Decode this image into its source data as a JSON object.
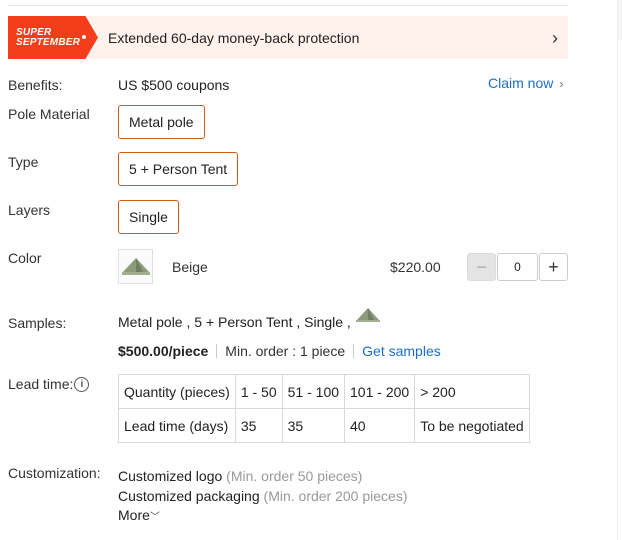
{
  "promo": {
    "badge_line1": "SUPER",
    "badge_line2": "SEPTEMBER",
    "text": "Extended 60-day money-back protection"
  },
  "benefits": {
    "label": "Benefits:",
    "value": "US $500 coupons",
    "claim_label": "Claim now"
  },
  "pole_material": {
    "label": "Pole Material",
    "option": "Metal pole"
  },
  "type": {
    "label": "Type",
    "option": "5 + Person Tent"
  },
  "layers": {
    "label": "Layers",
    "option": "Single"
  },
  "color": {
    "label": "Color",
    "name": "Beige",
    "price": "$220.00",
    "quantity": "0",
    "minus": "−",
    "plus": "+"
  },
  "samples": {
    "label": "Samples:",
    "selection": "Metal pole , 5 + Person Tent , Single ,",
    "price": "$500.00/piece",
    "min_order": "Min. order : 1 piece",
    "link": "Get samples"
  },
  "lead_time": {
    "label": "Lead time:",
    "info_icon": "i",
    "header_label": "Quantity (pieces)",
    "row_label": "Lead time (days)",
    "quantities": [
      "1 - 50",
      "51 - 100",
      "101 - 200",
      "> 200"
    ],
    "days": [
      "35",
      "35",
      "40",
      "To be negotiated"
    ]
  },
  "customization": {
    "label": "Customization:",
    "items": [
      {
        "name": "Customized logo",
        "note": "(Min. order 50 pieces)"
      },
      {
        "name": "Customized packaging",
        "note": "(Min. order 200 pieces)"
      }
    ],
    "more": "More"
  },
  "colors": {
    "accent_orange": "#d55a1a",
    "promo_red": "#f53d1b",
    "link_blue": "#1a6ec8",
    "tent_green": "#8a9a7a"
  }
}
